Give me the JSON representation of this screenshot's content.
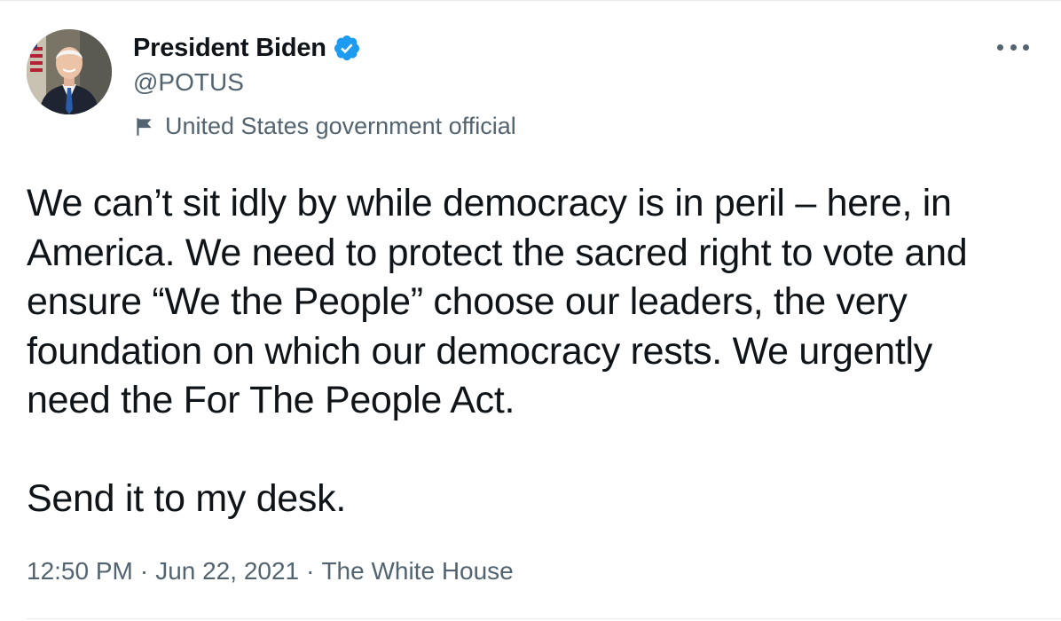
{
  "author": {
    "display_name": "President Biden",
    "handle": "@POTUS",
    "label": "United States government official",
    "verified": true
  },
  "icons": {
    "verified": "verified-badge-icon",
    "label": "flag-icon",
    "more": "more-options-icon"
  },
  "tweet": {
    "lines": [
      "We can’t sit idly by while democracy is in peril – here, in",
      "America. We need to protect the sacred right to vote and",
      "ensure “We the People” choose our leaders, the very",
      "foundation on which our democracy rests. We urgently",
      "need the For The People Act."
    ],
    "closing": "Send it to my desk."
  },
  "meta": {
    "time": "12:50 PM",
    "separator": "·",
    "date": "Jun 22, 2021",
    "source": "The White House"
  },
  "colors": {
    "text": "#0f1419",
    "secondary": "#536471",
    "verified_blue": "#1d9bf0",
    "divider": "#e6ecf0"
  }
}
